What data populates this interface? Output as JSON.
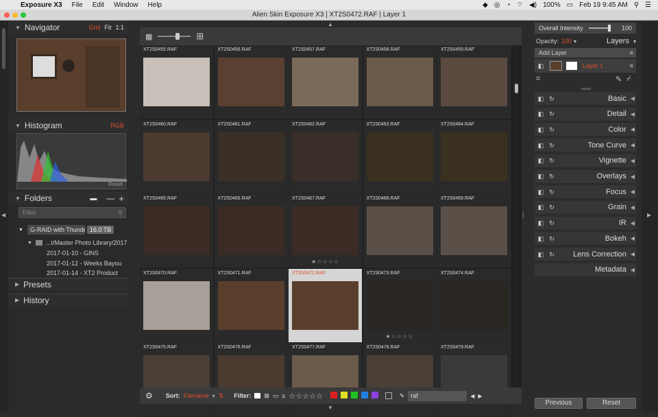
{
  "menubar": {
    "app": "Exposure X3",
    "items": [
      "File",
      "Edit",
      "Window",
      "Help"
    ],
    "battery": "100%",
    "clock": "Feb 19  9:45 AM"
  },
  "window": {
    "title": "Alien Skin Exposure X3 | XT2S0472.RAF | Layer 1"
  },
  "left": {
    "navigator": "Navigator",
    "nav_grid": "Grid",
    "nav_fit": "Fit",
    "nav_11": "1:1",
    "histogram": "Histogram",
    "hist_mode": "RGB",
    "reset": "Reset",
    "folders": "Folders",
    "filter_placeholder": "Filter",
    "drive": "G-RAID with Thunderb",
    "drive_size": "16.0 TB",
    "folder_path": "...t/Master Photo Library/2017",
    "subfolders": [
      "2017-01-10 - GINS",
      "2017-01-12 - Weeks Bayou",
      "2017-01-14 - XT2 Product"
    ],
    "presets": "Presets",
    "history": "History"
  },
  "grid": {
    "cells": [
      {
        "name": "XT2S0455.RAF",
        "thumb": "#c8c0b8",
        "stars": ""
      },
      {
        "name": "XT2S0456.RAF",
        "thumb": "#5a4030",
        "stars": ""
      },
      {
        "name": "XT2S0457.RAF",
        "thumb": "#7a6a5a",
        "stars": ""
      },
      {
        "name": "XT2S0458.RAF",
        "thumb": "#6a5a4a",
        "stars": ""
      },
      {
        "name": "XT2S0459.RAF",
        "thumb": "#5a4a40",
        "stars": ""
      },
      {
        "name": "XT2S0460.RAF",
        "thumb": "#4a3a30",
        "stars": ""
      },
      {
        "name": "XT2S0461.RAF",
        "thumb": "#3a3028",
        "stars": ""
      },
      {
        "name": "XT2S0462.RAF",
        "thumb": "#3a2e28",
        "stars": ""
      },
      {
        "name": "XT2S0463.RAF",
        "thumb": "#3a3020",
        "stars": ""
      },
      {
        "name": "XT2S0464.RAF",
        "thumb": "#3a3020",
        "stars": ""
      },
      {
        "name": "XT2S0465.RAF",
        "thumb": "#3a2c24",
        "stars": ""
      },
      {
        "name": "XT2S0466.RAF",
        "thumb": "#3a2c24",
        "stars": ""
      },
      {
        "name": "XT2S0467.RAF",
        "thumb": "#3a2c24",
        "stars": "★☆☆☆☆"
      },
      {
        "name": "XT2S0468.RAF",
        "thumb": "#5a5048",
        "stars": ""
      },
      {
        "name": "XT2S0469.RAF",
        "thumb": "#5a5048",
        "stars": ""
      },
      {
        "name": "XT2S0470.RAF",
        "thumb": "#a8a098",
        "stars": ""
      },
      {
        "name": "XT2S0471.RAF",
        "thumb": "#5a3e2c",
        "stars": ""
      },
      {
        "name": "XT2S0472.RAF",
        "thumb": "#5a3e2c",
        "stars": "",
        "selected": true
      },
      {
        "name": "XT2S0473.RAF",
        "thumb": "#2a2622",
        "stars": "★☆☆☆☆"
      },
      {
        "name": "XT2S0474.RAF",
        "thumb": "#2a2622",
        "stars": ""
      },
      {
        "name": "XT2S0475.RAF",
        "thumb": "#4a4038",
        "stars": ""
      },
      {
        "name": "XT2S0476.RAF",
        "thumb": "#4a3a30",
        "stars": ""
      },
      {
        "name": "XT2S0477.RAF",
        "thumb": "#6a5a4a",
        "stars": ""
      },
      {
        "name": "XT2S0478.RAF",
        "thumb": "#4a4038",
        "stars": ""
      },
      {
        "name": "XT2S0479.RAF",
        "thumb": "#3a3a3a",
        "stars": ""
      }
    ]
  },
  "bottombar": {
    "sort_label": "Sort:",
    "sort_value": "Filename",
    "filter_label": "Filter:",
    "search": "raf",
    "color_swatches": [
      "#e02020",
      "#e0e020",
      "#20c020",
      "#2080e0",
      "#9040e0"
    ]
  },
  "right": {
    "overall": "Overall Intensity",
    "overall_val": "100",
    "opacity_label": "Opacity:",
    "opacity_val": "100",
    "layers": "Layers",
    "add_layer": "Add Layer",
    "layer1": "Layer 1",
    "panels": [
      "Basic",
      "Detail",
      "Color",
      "Tone Curve",
      "Vignette",
      "Overlays",
      "Focus",
      "Grain",
      "IR",
      "Bokeh",
      "Lens Correction",
      "Metadata"
    ],
    "previous": "Previous",
    "reset": "Reset"
  }
}
